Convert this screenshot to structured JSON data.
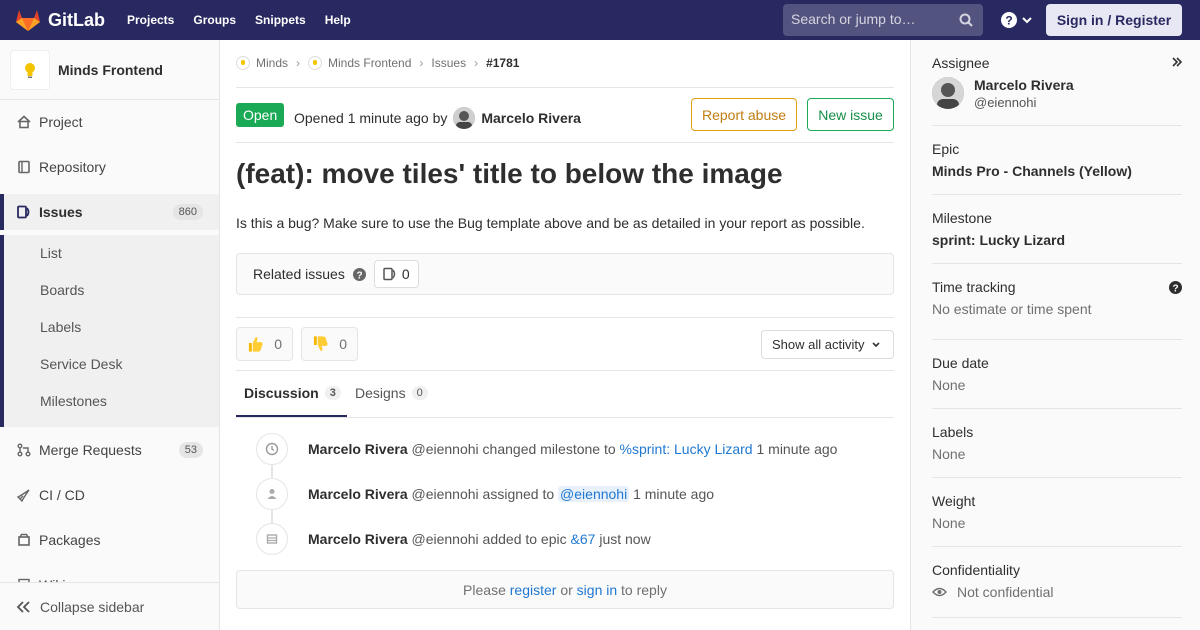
{
  "navbar": {
    "brand": "GitLab",
    "links": [
      "Projects",
      "Groups",
      "Snippets",
      "Help"
    ],
    "search_placeholder": "Search or jump to…",
    "sign_in": "Sign in / Register"
  },
  "sidebar": {
    "project_name": "Minds Frontend",
    "items": [
      {
        "label": "Project",
        "icon": "home-icon"
      },
      {
        "label": "Repository",
        "icon": "book-icon"
      },
      {
        "label": "Issues",
        "icon": "issues-icon",
        "count": "860"
      },
      {
        "label": "Merge Requests",
        "icon": "merge-icon",
        "count": "53"
      },
      {
        "label": "CI / CD",
        "icon": "rocket-icon"
      },
      {
        "label": "Packages",
        "icon": "package-icon"
      },
      {
        "label": "Wiki",
        "icon": "wiki-icon"
      }
    ],
    "sub_items": [
      "List",
      "Boards",
      "Labels",
      "Service Desk",
      "Milestones"
    ],
    "collapse": "Collapse sidebar"
  },
  "breadcrumbs": {
    "group": "Minds",
    "project": "Minds Frontend",
    "section": "Issues",
    "current": "#1781"
  },
  "issue": {
    "status": "Open",
    "opened_prefix": "Opened",
    "opened_time": "1 minute ago",
    "by": "by",
    "author": "Marcelo Rivera",
    "report_abuse": "Report abuse",
    "new_issue": "New issue",
    "title": "(feat): move tiles' title to below the image",
    "description": "Is this a bug? Make sure to use the Bug template above and be as detailed in your report as possible.",
    "related_label": "Related issues",
    "related_count": "0"
  },
  "awards": {
    "thumbs_up": "0",
    "thumbs_down": "0",
    "activity_filter": "Show all activity"
  },
  "tabs": {
    "discussion": "Discussion",
    "discussion_count": "3",
    "designs": "Designs",
    "designs_count": "0"
  },
  "notes": [
    {
      "name": "Marcelo Rivera",
      "user": "@eiennohi",
      "action": "changed milestone to",
      "link": "%sprint: Lucky Lizard",
      "time": "1 minute ago",
      "icon": "clock-icon"
    },
    {
      "name": "Marcelo Rivera",
      "user": "@eiennohi",
      "action": "assigned to",
      "link": "@eiennohi",
      "time": "1 minute ago",
      "icon": "user-icon"
    },
    {
      "name": "Marcelo Rivera",
      "user": "@eiennohi",
      "action": "added to epic",
      "link": "&67",
      "time": "just now",
      "icon": "epic-icon"
    }
  ],
  "reply": {
    "please": "Please",
    "register": "register",
    "or": "or",
    "sign_in": "sign in",
    "to_reply": "to reply"
  },
  "right_sidebar": {
    "assignee_title": "Assignee",
    "assignee_name": "Marcelo Rivera",
    "assignee_user": "@eiennohi",
    "epic_title": "Epic",
    "epic_value": "Minds Pro - Channels (Yellow)",
    "milestone_title": "Milestone",
    "milestone_value": "sprint: Lucky Lizard",
    "time_title": "Time tracking",
    "time_value": "No estimate or time spent",
    "due_title": "Due date",
    "due_value": "None",
    "labels_title": "Labels",
    "labels_value": "None",
    "weight_title": "Weight",
    "weight_value": "None",
    "conf_title": "Confidentiality",
    "conf_value": "Not confidential"
  },
  "colors": {
    "navbar": "#292961",
    "open": "#1aaa55",
    "link": "#1f78d1",
    "abuse": "#e4a01a"
  }
}
